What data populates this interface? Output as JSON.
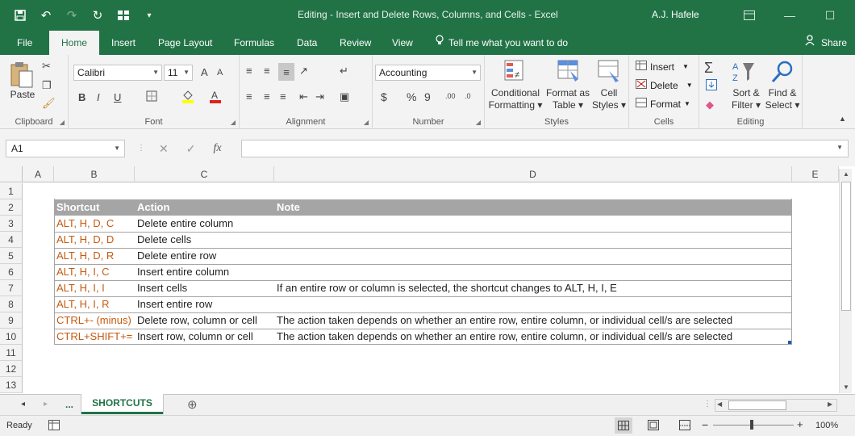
{
  "titlebar": {
    "title": "Editing - Insert and Delete Rows, Columns, and Cells  -  Excel",
    "user": "A.J. Hafele",
    "minimize": "—",
    "restore": "☐",
    "close": "✕"
  },
  "qat": {
    "save": "💾",
    "undo": "↶",
    "redo": "↷",
    "refresh": "↻",
    "customize": "▾"
  },
  "tabs": {
    "file": "File",
    "home": "Home",
    "insert": "Insert",
    "page_layout": "Page Layout",
    "formulas": "Formulas",
    "data": "Data",
    "review": "Review",
    "view": "View",
    "tell_me": "Tell me what you want to do",
    "share": "Share"
  },
  "ribbon": {
    "clipboard": {
      "label": "Clipboard",
      "paste": "Paste"
    },
    "font": {
      "label": "Font",
      "name": "Calibri",
      "size": "11",
      "bold": "B",
      "italic": "I",
      "underline": "U",
      "grow": "A",
      "shrink": "A"
    },
    "alignment": {
      "label": "Alignment"
    },
    "number": {
      "label": "Number",
      "format": "Accounting",
      "currency": "$",
      "percent": "%",
      "comma": "9",
      "inc_decimal": ".00",
      "dec_decimal": ".0"
    },
    "styles": {
      "label": "Styles",
      "conditional": "Conditional",
      "conditional2": "Formatting",
      "format_as": "Format as",
      "format_as2": "Table",
      "cell": "Cell",
      "cell2": "Styles"
    },
    "cells": {
      "label": "Cells",
      "insert": "Insert",
      "delete": "Delete",
      "format": "Format"
    },
    "editing": {
      "label": "Editing",
      "sort": "Sort &",
      "sort2": "Filter",
      "find": "Find &",
      "find2": "Select"
    }
  },
  "formula_bar": {
    "name_box": "A1",
    "cancel": "✕",
    "enter": "✓",
    "fx": "fx",
    "value": ""
  },
  "columns": [
    "A",
    "B",
    "C",
    "D",
    "E"
  ],
  "rows": [
    "1",
    "2",
    "3",
    "4",
    "5",
    "6",
    "7",
    "8",
    "9",
    "10",
    "11",
    "12",
    "13"
  ],
  "table": {
    "headers": {
      "shortcut": "Shortcut",
      "action": "Action",
      "note": "Note"
    },
    "rows": [
      {
        "shortcut": "ALT, H, D, C",
        "action": "Delete entire column",
        "note": ""
      },
      {
        "shortcut": "ALT, H, D, D",
        "action": "Delete cells",
        "note": ""
      },
      {
        "shortcut": "ALT, H, D, R",
        "action": "Delete entire row",
        "note": ""
      },
      {
        "shortcut": "ALT, H, I, C",
        "action": "Insert entire column",
        "note": ""
      },
      {
        "shortcut": "ALT, H, I, I",
        "action": "Insert cells",
        "note": "If an entire row or column is selected, the shortcut changes to ALT, H, I, E"
      },
      {
        "shortcut": "ALT, H, I, R",
        "action": "Insert entire row",
        "note": ""
      },
      {
        "shortcut": "CTRL+- (minus)",
        "action": "Delete row, column or cell",
        "note": "The action taken depends on whether an entire row, entire column, or individual cell/s are selected"
      },
      {
        "shortcut": "CTRL+SHIFT+=",
        "action": "Insert row, column or cell",
        "note": "The action taken depends on whether an entire row, entire column, or individual cell/s are selected"
      }
    ]
  },
  "sheets": {
    "prev": "◂",
    "next": "▸",
    "more": "...",
    "active": "SHORTCUTS",
    "add": "⊕"
  },
  "status": {
    "ready": "Ready",
    "zoom": "100%",
    "zoom_out": "−",
    "zoom_in": "+"
  },
  "colors": {
    "accent": "#217346",
    "shortcut_text": "#c55a11",
    "header_fill": "#a5a5a5"
  }
}
